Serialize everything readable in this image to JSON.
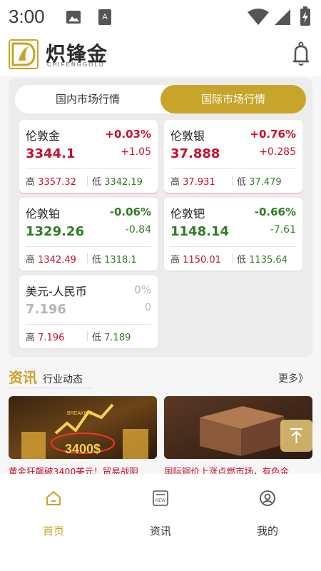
{
  "status_bar": {
    "time": "3:00"
  },
  "header": {
    "brand": "炽锋金",
    "brand_sub": "CHIFENGGOLD"
  },
  "market": {
    "tabs": [
      {
        "label": "国内市场行情",
        "active": false
      },
      {
        "label": "国际市场行情",
        "active": true
      }
    ],
    "cards": [
      {
        "name": "伦敦金",
        "pct": "+0.03%",
        "price": "3344.1",
        "change": "+1.05",
        "high_label": "高",
        "high": "3357.32",
        "low_label": "低",
        "low": "3342.19",
        "trend": "up"
      },
      {
        "name": "伦敦银",
        "pct": "+0.76%",
        "price": "37.888",
        "change": "+0.285",
        "high_label": "高",
        "high": "37.931",
        "low_label": "低",
        "low": "37.479",
        "trend": "up"
      },
      {
        "name": "伦敦铂",
        "pct": "-0.06%",
        "price": "1329.26",
        "change": "-0.84",
        "high_label": "高",
        "high": "1342.49",
        "low_label": "低",
        "low": "1318.1",
        "trend": "down"
      },
      {
        "name": "伦敦钯",
        "pct": "-0.66%",
        "price": "1148.14",
        "change": "-7.61",
        "high_label": "高",
        "high": "1150.01",
        "low_label": "低",
        "low": "1135.64",
        "trend": "down"
      },
      {
        "name": "美元-人民币",
        "pct": "0%",
        "price": "7.196",
        "change": "0",
        "high_label": "高",
        "high": "7.196",
        "low_label": "低",
        "low": "7.189",
        "trend": "flat"
      }
    ]
  },
  "news": {
    "title": "资讯",
    "subtitle": "行业动态",
    "more": "更多》",
    "items": [
      {
        "caption": "黄金狂飙破3400美元！贸易战阴",
        "image_text": "3400$",
        "image_tag": "BREAKING"
      },
      {
        "caption": "国际铜价上涨点燃市场，有色金"
      }
    ]
  },
  "bottom_nav": [
    {
      "label": "首页",
      "icon": "home-icon",
      "active": true
    },
    {
      "label": "资讯",
      "icon": "newspaper-icon",
      "active": false
    },
    {
      "label": "我的",
      "icon": "user-icon",
      "active": false
    }
  ],
  "colors": {
    "gold": "#c9a42a",
    "up": "#c8102e",
    "down": "#2e7d22",
    "flat": "#b5b5b5"
  }
}
